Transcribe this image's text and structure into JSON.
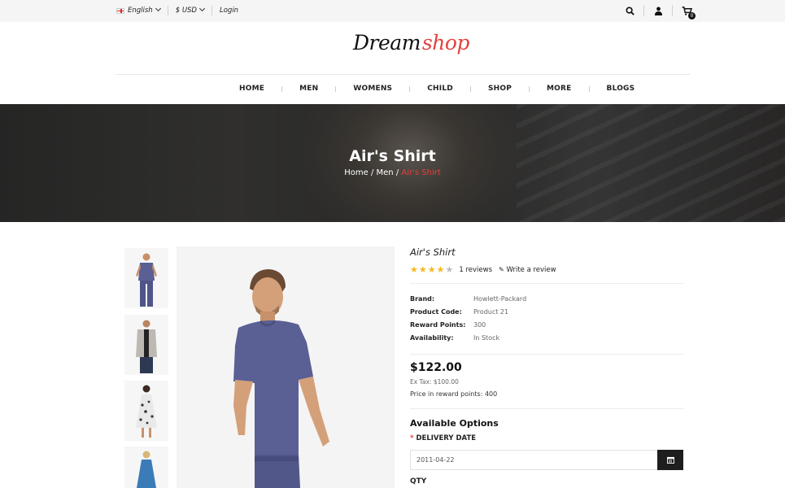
{
  "topbar": {
    "language": "English",
    "currency": "$ USD",
    "login": "Login",
    "cart_count": "0",
    "icons": [
      "search-icon",
      "user-icon",
      "cart-icon"
    ]
  },
  "logo": {
    "part1": "Dream",
    "part2": "shop"
  },
  "nav": {
    "items": [
      "HOME",
      "MEN",
      "WOMENS",
      "CHILD",
      "SHOP",
      "MORE",
      "BLOGS"
    ]
  },
  "hero": {
    "title": "Air's Shirt",
    "breadcrumb": [
      "Home",
      "Men",
      "Air's Shirt"
    ]
  },
  "product": {
    "title": "Air's Shirt",
    "rating": 4,
    "rating_max": 5,
    "reviews": "1 reviews",
    "write_review": "Write a review",
    "specs": [
      {
        "key": "Brand:",
        "value": "Howlett-Packard"
      },
      {
        "key": "Product Code:",
        "value": "Product 21"
      },
      {
        "key": "Reward Points:",
        "value": "300"
      },
      {
        "key": "Availability:",
        "value": "In Stock"
      }
    ],
    "price": "$122.00",
    "ex_tax": "Ex Tax: $100.00",
    "reward_price": "Price in reward points: 400"
  },
  "options": {
    "title": "Available Options",
    "delivery_label": "DELIVERY DATE",
    "delivery_value": "2011-04-22",
    "qty_label": "QTY"
  },
  "colors": {
    "accent": "#e4413d",
    "dark": "#1e1e1e",
    "star": "#f6b91c",
    "shirt": "#5a5f94"
  }
}
